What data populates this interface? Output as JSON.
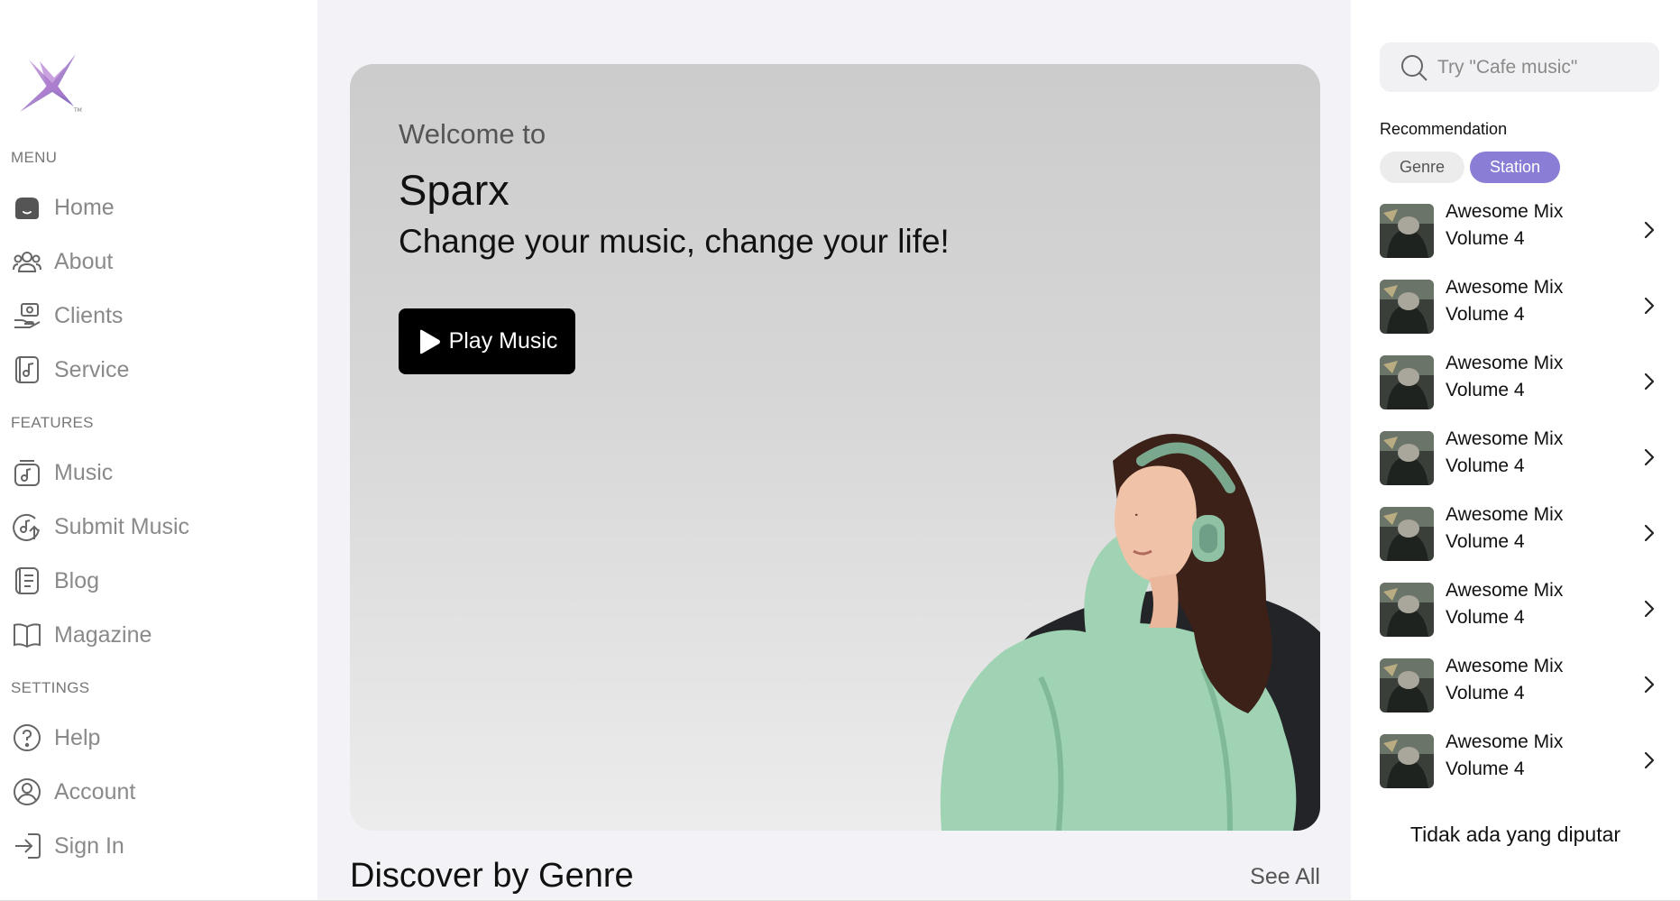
{
  "sidebar": {
    "sections": {
      "menu": "MENU",
      "features": "FEATURES",
      "settings": "SETTINGS"
    },
    "items": [
      {
        "label": "Home",
        "icon": "home-icon"
      },
      {
        "label": "About",
        "icon": "users-icon"
      },
      {
        "label": "Clients",
        "icon": "clients-icon"
      },
      {
        "label": "Service",
        "icon": "service-icon"
      },
      {
        "label": "Music",
        "icon": "music-icon"
      },
      {
        "label": "Submit Music",
        "icon": "submit-music-icon"
      },
      {
        "label": "Blog",
        "icon": "blog-icon"
      },
      {
        "label": "Magazine",
        "icon": "book-icon"
      },
      {
        "label": "Help",
        "icon": "help-icon"
      },
      {
        "label": "Account",
        "icon": "account-icon"
      },
      {
        "label": "Sign In",
        "icon": "sign-in-icon"
      }
    ]
  },
  "hero": {
    "welcome": "Welcome to",
    "brand": "Sparx",
    "tagline": "Change your music, change your life!",
    "play_label": "Play Music"
  },
  "discover": {
    "title": "Discover by Genre",
    "see_all": "See All"
  },
  "right_panel": {
    "search_placeholder": "Try \"Cafe music\"",
    "recommendation_title": "Recommendation",
    "chips": [
      {
        "label": "Genre",
        "active": false
      },
      {
        "label": "Station",
        "active": true
      }
    ],
    "items": [
      {
        "title": "Awesome Mix Volume 4"
      },
      {
        "title": "Awesome Mix Volume 4"
      },
      {
        "title": "Awesome Mix Volume 4"
      },
      {
        "title": "Awesome Mix Volume 4"
      },
      {
        "title": "Awesome Mix Volume 4"
      },
      {
        "title": "Awesome Mix Volume 4"
      },
      {
        "title": "Awesome Mix Volume 4"
      },
      {
        "title": "Awesome Mix Volume 4"
      }
    ],
    "now_playing": "Tidak ada yang diputar"
  },
  "colors": {
    "accent": "#8a7dd6",
    "main_bg": "#f3f3f7",
    "button_bg": "#000000",
    "hoodie": "#9fd3b4"
  }
}
